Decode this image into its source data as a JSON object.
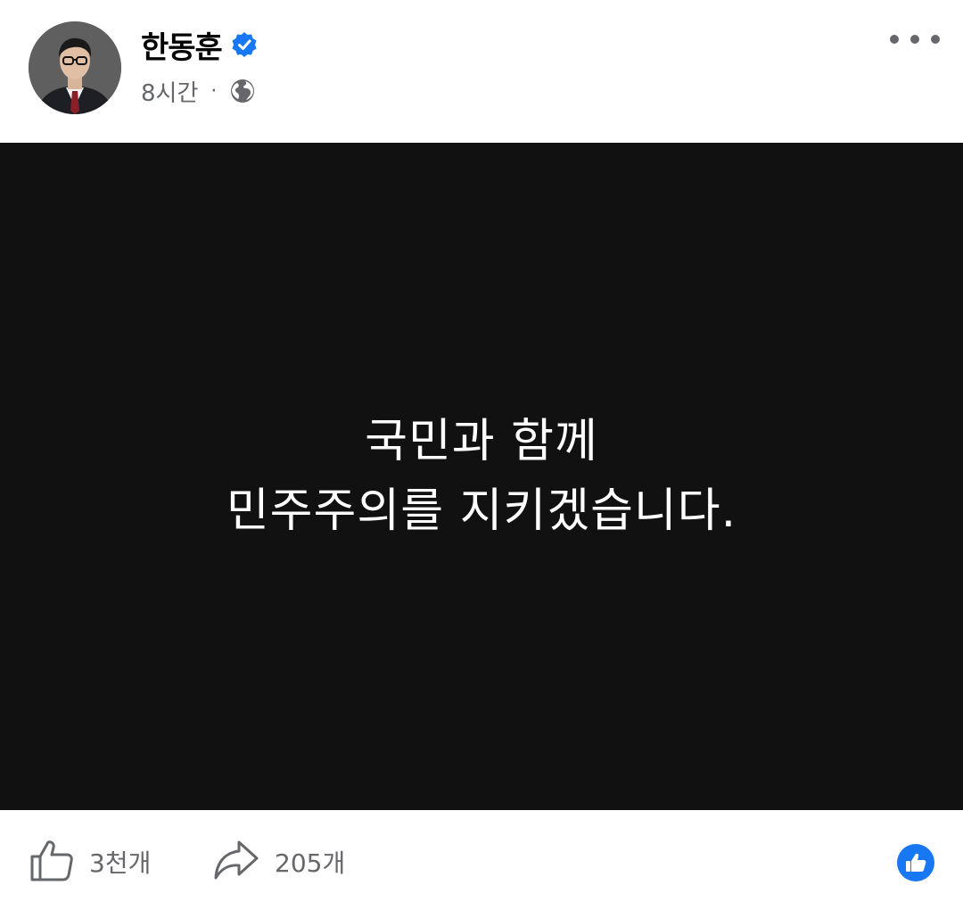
{
  "post": {
    "author_name": "한동훈",
    "verified": true,
    "timestamp": "8시간",
    "separator": "·",
    "audience_icon": "globe-icon",
    "more_icon": "more-horizontal-icon"
  },
  "media": {
    "line1": "국민과 함께",
    "line2": "민주주의를 지키겠습니다.",
    "background_color": "#111111",
    "text_color": "#ffffff"
  },
  "footer": {
    "like_icon": "thumbs-up-outline-icon",
    "like_count": "3천개",
    "share_icon": "share-arrow-icon",
    "share_count": "205개",
    "reaction_icon": "like-reaction-icon"
  },
  "colors": {
    "verified_blue": "#1877f2",
    "secondary_text": "#65676b",
    "primary_text": "#050505"
  }
}
